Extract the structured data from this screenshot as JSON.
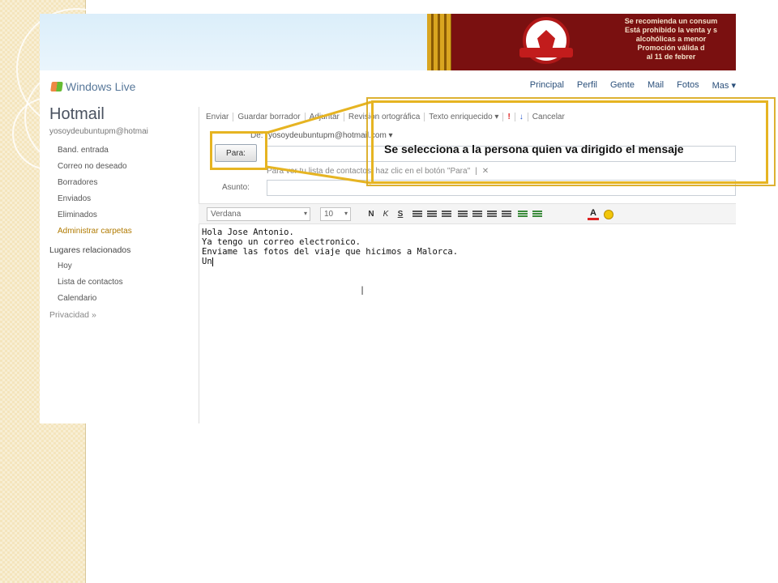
{
  "annotation": {
    "callout_text": "Se selecciona a la persona quien va dirigido el mensaje",
    "highlight_color": "#e6b422"
  },
  "banner": {
    "promo_lines": [
      "Se recomienda un consum",
      "Está prohibido la venta y s",
      "alcohólicas a menor",
      "Promoción válida d",
      "al 11 de febrer"
    ]
  },
  "nav": {
    "logo": "Windows Live",
    "links": [
      "Principal",
      "Perfil",
      "Gente",
      "Mail",
      "Fotos",
      "Mas ▾"
    ]
  },
  "sidebar": {
    "title": "Hotmail",
    "account": "yosoydeubuntupm@hotmai",
    "items": [
      {
        "label": "Band. entrada",
        "type": "sub"
      },
      {
        "label": "Correo no deseado",
        "type": "sub"
      },
      {
        "label": "Borradores",
        "type": "sub"
      },
      {
        "label": "Enviados",
        "type": "sub"
      },
      {
        "label": "Eliminados",
        "type": "sub"
      },
      {
        "label": "Administrar carpetas",
        "type": "sub"
      },
      {
        "label": "Lugares relacionados",
        "type": "head"
      },
      {
        "label": "Hoy",
        "type": "sub"
      },
      {
        "label": "Lista de contactos",
        "type": "sub"
      },
      {
        "label": "Calendario",
        "type": "sub"
      },
      {
        "label": "Privacidad »",
        "type": "head"
      }
    ]
  },
  "toolbar": {
    "items": [
      "Enviar",
      "Guardar borrador",
      "Adjuntar",
      "Revisión ortográfica",
      "Texto enriquecido ▾",
      "!",
      "↓",
      "Cancelar"
    ]
  },
  "compose": {
    "from_label": "De:",
    "from_value": "yosoydeubuntupm@hotmail.com ▾",
    "to_button": "Para:",
    "to_hint": "Para ver tu lista de contactos, haz clic en el botón \"Para\"",
    "to_hint_sep": "|",
    "to_hint_close": "✕",
    "subject_label": "Asunto:",
    "font_name": "Verdana",
    "font_size": "10",
    "format_bold": "N",
    "format_italic": "K",
    "format_underline": "S",
    "color_letter": "A",
    "body_lines": [
      "Hola Jose Antonio.",
      "",
      "Ya tengo un correo electronico.",
      "Enviame las fotos del viaje que hicimos a Malorca.",
      "",
      "Un"
    ],
    "cursor_glyph": "I"
  }
}
